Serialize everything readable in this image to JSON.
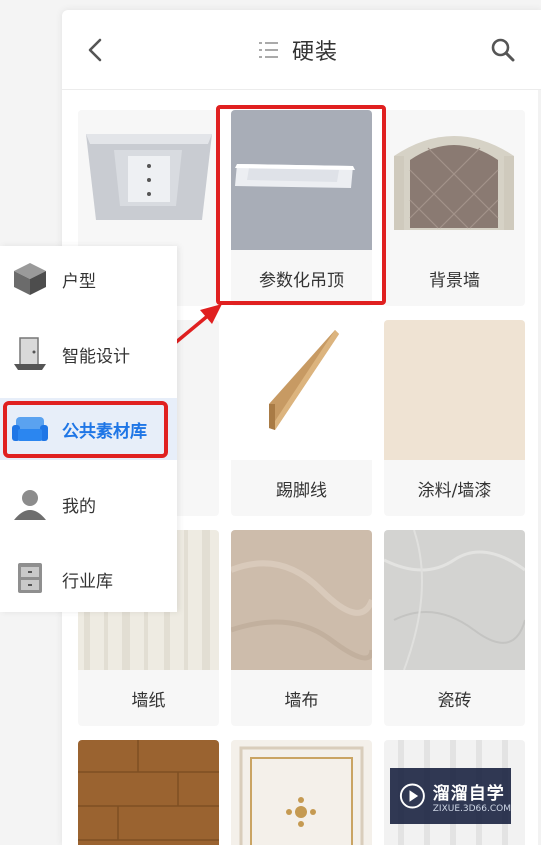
{
  "header": {
    "title": "硬装",
    "back_icon": "back-arrow-icon",
    "list_icon": "list-icon",
    "search_icon": "search-icon"
  },
  "tiles": [
    {
      "label": "",
      "image": "ceiling-panel"
    },
    {
      "label": "参数化吊顶",
      "image": "parametric-ceiling"
    },
    {
      "label": "背景墙",
      "image": "background-wall"
    },
    {
      "label": "",
      "image": "hidden"
    },
    {
      "label": "踢脚线",
      "image": "skirting-board"
    },
    {
      "label": "涂料/墙漆",
      "image": "wall-paint"
    },
    {
      "label": "墙纸",
      "image": "wallpaper"
    },
    {
      "label": "墙布",
      "image": "wall-cloth"
    },
    {
      "label": "瓷砖",
      "image": "tile"
    },
    {
      "label": "",
      "image": "wood-floor"
    },
    {
      "label": "",
      "image": "decorative-panel"
    },
    {
      "label": "",
      "image": "white-panel"
    }
  ],
  "sidebar": {
    "items": [
      {
        "label": "户型",
        "icon": "house-cube-icon",
        "active": false
      },
      {
        "label": "智能设计",
        "icon": "door-icon",
        "active": false
      },
      {
        "label": "公共素材库",
        "icon": "sofa-icon",
        "active": true
      },
      {
        "label": "我的",
        "icon": "user-icon",
        "active": false
      },
      {
        "label": "行业库",
        "icon": "cabinet-icon",
        "active": false
      }
    ]
  },
  "watermark": {
    "main": "溜溜自学",
    "sub": "ZIXUE.3D66.COM"
  },
  "colors": {
    "accent": "#1f76e6",
    "highlight": "#e02020",
    "active_bg": "#e7eef9"
  }
}
